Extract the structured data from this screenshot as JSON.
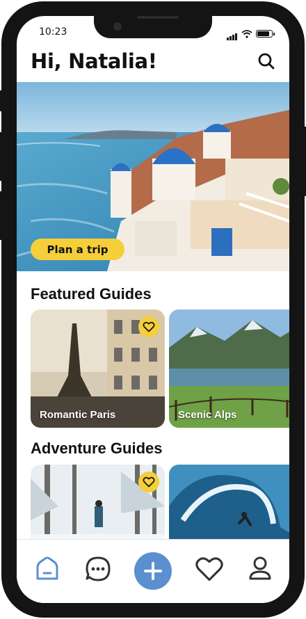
{
  "status_bar": {
    "time": "10:23"
  },
  "header": {
    "greeting": "Hi, Natalia!",
    "search_icon": "search-icon"
  },
  "hero": {
    "image": "santorini-coast-photo",
    "cta_label": "Plan a trip"
  },
  "featured": {
    "title": "Featured Guides",
    "cards": [
      {
        "label": "Romantic Paris",
        "image": "eiffel-tower-photo"
      },
      {
        "label": "Scenic Alps",
        "image": "alpine-lake-photo"
      }
    ]
  },
  "adventure": {
    "title": "Adventure Guides",
    "cards": [
      {
        "label": "",
        "image": "snow-forest-hiker-photo"
      },
      {
        "label": "",
        "image": "surfer-wave-photo"
      }
    ]
  },
  "tab_bar": {
    "items": [
      "home-icon",
      "chat-icon",
      "add-icon",
      "heart-icon",
      "profile-icon"
    ],
    "active": "home-icon"
  },
  "colors": {
    "accent_yellow": "#f5cf3a",
    "accent_blue": "#5b8fcf",
    "frame": "#141414"
  }
}
